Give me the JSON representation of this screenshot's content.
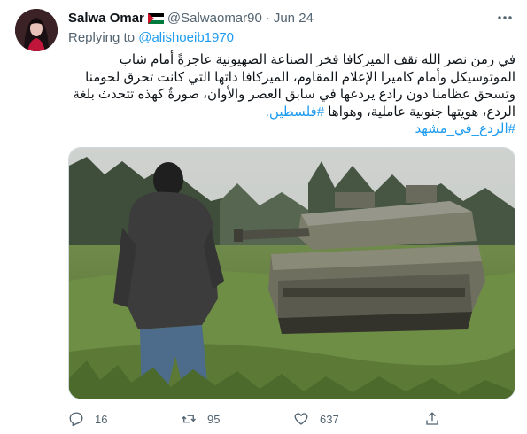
{
  "tweet": {
    "author_name": "Salwa Omar",
    "author_handle": "@Salwaomar90",
    "separator": "·",
    "date": "Jun 24",
    "replying_to_label": "Replying to",
    "replying_to_handle": "@alishoeib1970",
    "text_lines": [
      "في زمن نصر الله تقف الميركافا فخر الصناعة الصهيونية عاجزةً أمام شاب",
      "الموتوسيكل وأمام كاميرا الإعلام المقاوم، الميركافا ذاتها التي كانت تحرق لحومنا",
      "وتسحق عظامنا دون رادع يردعها في سابق العصر والأوان، صورةٌ كهذه تتحدث بلغة"
    ],
    "text_line4": "الردع، هويتها جنوبية عاملية، وهواها",
    "hashtag_inline": "#فلسطين.",
    "hashtag_line": "#الردع_في_مشهد"
  },
  "icons": {
    "flag": "palestine-flag-icon",
    "more": "more-icon",
    "reply": "reply-icon",
    "retweet": "retweet-icon",
    "like": "like-icon",
    "share": "share-icon"
  },
  "stats": {
    "replies": "16",
    "retweets": "95",
    "likes": "637"
  },
  "colors": {
    "link": "#1d9bf0",
    "secondary_text": "#536471",
    "flag_red": "#ce1126",
    "flag_green": "#007a3d"
  }
}
